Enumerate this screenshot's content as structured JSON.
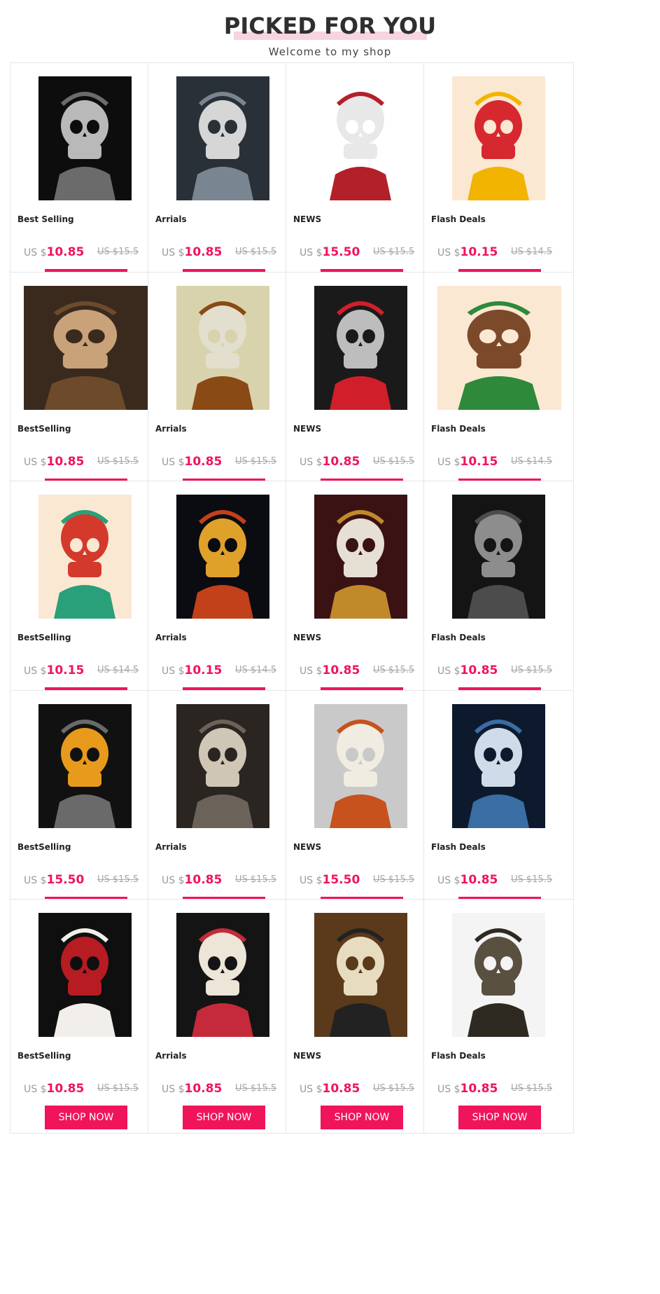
{
  "header": {
    "title": "PICKED FOR YOU",
    "subtitle": "Welcome to my shop"
  },
  "theme": {
    "accent": "#f0145a",
    "title_highlight": "#f6d5de"
  },
  "button_label": "SHOP NOW",
  "products": [
    {
      "tag": "Best Selling",
      "currency": "US $",
      "price": "10.85",
      "old_price": "US $15.5",
      "image": "mummy-skeleton-art"
    },
    {
      "tag": "Arrials",
      "currency": "US $",
      "price": "10.85",
      "old_price": "US $15.5",
      "image": "ghost-ship-skeleton-art"
    },
    {
      "tag": "NEWS",
      "currency": "US $",
      "price": "15.50",
      "old_price": "US $15.5",
      "image": "headdress-skull-art"
    },
    {
      "tag": "Flash Deals",
      "currency": "US $",
      "price": "10.15",
      "old_price": "US $14.5",
      "image": "cartoon-chief-art"
    },
    {
      "tag": "BestSelling",
      "currency": "US $",
      "price": "10.85",
      "old_price": "US $15.5",
      "image": "skeleton-kings-cards-art"
    },
    {
      "tag": "Arrials",
      "currency": "US $",
      "price": "10.85",
      "old_price": "US $15.5",
      "image": "feather-headdress-skull-art"
    },
    {
      "tag": "NEWS",
      "currency": "US $",
      "price": "10.85",
      "old_price": "US $15.5",
      "image": "sugar-skull-woman-art"
    },
    {
      "tag": "Flash Deals",
      "currency": "US $",
      "price": "10.15",
      "old_price": "US $14.5",
      "image": "cartoon-native-girl-art"
    },
    {
      "tag": "BestSelling",
      "currency": "US $",
      "price": "10.15",
      "old_price": "US $14.5",
      "image": "cartoon-chief-pipe-art"
    },
    {
      "tag": "Arrials",
      "currency": "US $",
      "price": "10.15",
      "old_price": "US $14.5",
      "image": "pharaoh-mask-art"
    },
    {
      "tag": "NEWS",
      "currency": "US $",
      "price": "10.85",
      "old_price": "US $15.5",
      "image": "skeleton-couple-sombrero-art"
    },
    {
      "tag": "Flash Deals",
      "currency": "US $",
      "price": "10.85",
      "old_price": "US $15.5",
      "image": "skeleton-motorcycle-art"
    },
    {
      "tag": "BestSelling",
      "currency": "US $",
      "price": "15.50",
      "old_price": "US $15.5",
      "image": "anubis-art"
    },
    {
      "tag": "Arrials",
      "currency": "US $",
      "price": "10.85",
      "old_price": "US $15.5",
      "image": "screaming-skulls-art"
    },
    {
      "tag": "NEWS",
      "currency": "US $",
      "price": "15.50",
      "old_price": "US $15.5",
      "image": "headdress-skull-axes-art"
    },
    {
      "tag": "Flash Deals",
      "currency": "US $",
      "price": "10.85",
      "old_price": "US $15.5",
      "image": "hooded-reaper-art"
    },
    {
      "tag": "BestSelling",
      "currency": "US $",
      "price": "10.85",
      "old_price": "US $15.5",
      "image": "flag-skull-art"
    },
    {
      "tag": "Arrials",
      "currency": "US $",
      "price": "10.85",
      "old_price": "US $15.5",
      "image": "floral-sugar-skull-art"
    },
    {
      "tag": "NEWS",
      "currency": "US $",
      "price": "10.85",
      "old_price": "US $15.5",
      "image": "pharaoh-bust-art"
    },
    {
      "tag": "Flash Deals",
      "currency": "US $",
      "price": "10.85",
      "old_price": "US $15.5",
      "image": "reaper-fists-art"
    }
  ]
}
